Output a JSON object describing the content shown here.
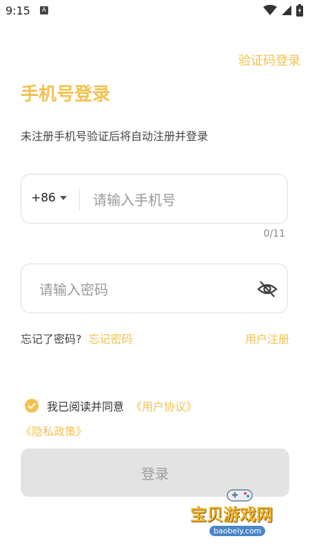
{
  "status_bar": {
    "time": "9:15",
    "badge": "A"
  },
  "header": {
    "otp_login": "验证码登录",
    "title": "手机号登录",
    "subtitle": "未注册手机号验证后将自动注册并登录"
  },
  "phone": {
    "country_code": "+86",
    "placeholder": "请输入手机号",
    "value": "",
    "counter": "0/11"
  },
  "password": {
    "placeholder": "请输入密码",
    "value": ""
  },
  "links": {
    "forgot_label": "忘记了密码?",
    "forgot_link": "忘记密码",
    "register": "用户注册"
  },
  "agreement": {
    "checked": true,
    "text": "我已阅读并同意",
    "user_agreement": "《用户协议》",
    "privacy_policy": "《隐私政策》"
  },
  "login_button": "登录",
  "watermark": {
    "cn": "宝贝游戏网",
    "url": "baobeiy.com"
  },
  "colors": {
    "accent": "#f2c14e",
    "button_bg": "#e3e3e3",
    "button_text": "#9b9b9b"
  }
}
